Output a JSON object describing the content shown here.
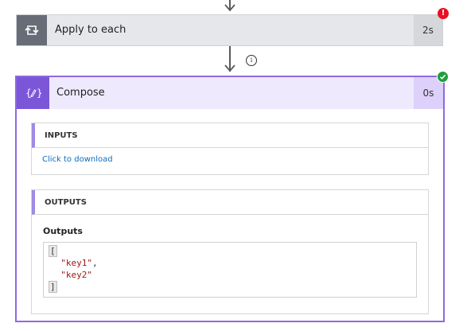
{
  "apply_to_each": {
    "title": "Apply to each",
    "duration": "2s",
    "status_badge": "!",
    "icon": "loop-icon"
  },
  "info_icon": {
    "glyph": "i"
  },
  "compose": {
    "title": "Compose",
    "duration": "0s",
    "icon": "compose-expression-icon",
    "status": "success",
    "accent_color": "#7b56d9",
    "inputs": {
      "header": "INPUTS",
      "link": "Click to download"
    },
    "outputs": {
      "header": "OUTPUTS",
      "label": "Outputs",
      "json_lines": [
        "[",
        "  \"key1\",",
        "  \"key2\"",
        "]"
      ],
      "open_bracket": "[",
      "item1": "\"key1\"",
      "item1_suffix": ",",
      "item2": "\"key2\"",
      "close_bracket": "]"
    }
  },
  "colors": {
    "error": "#e81123",
    "success": "#1e9e3c",
    "link": "#0f6cbd"
  }
}
